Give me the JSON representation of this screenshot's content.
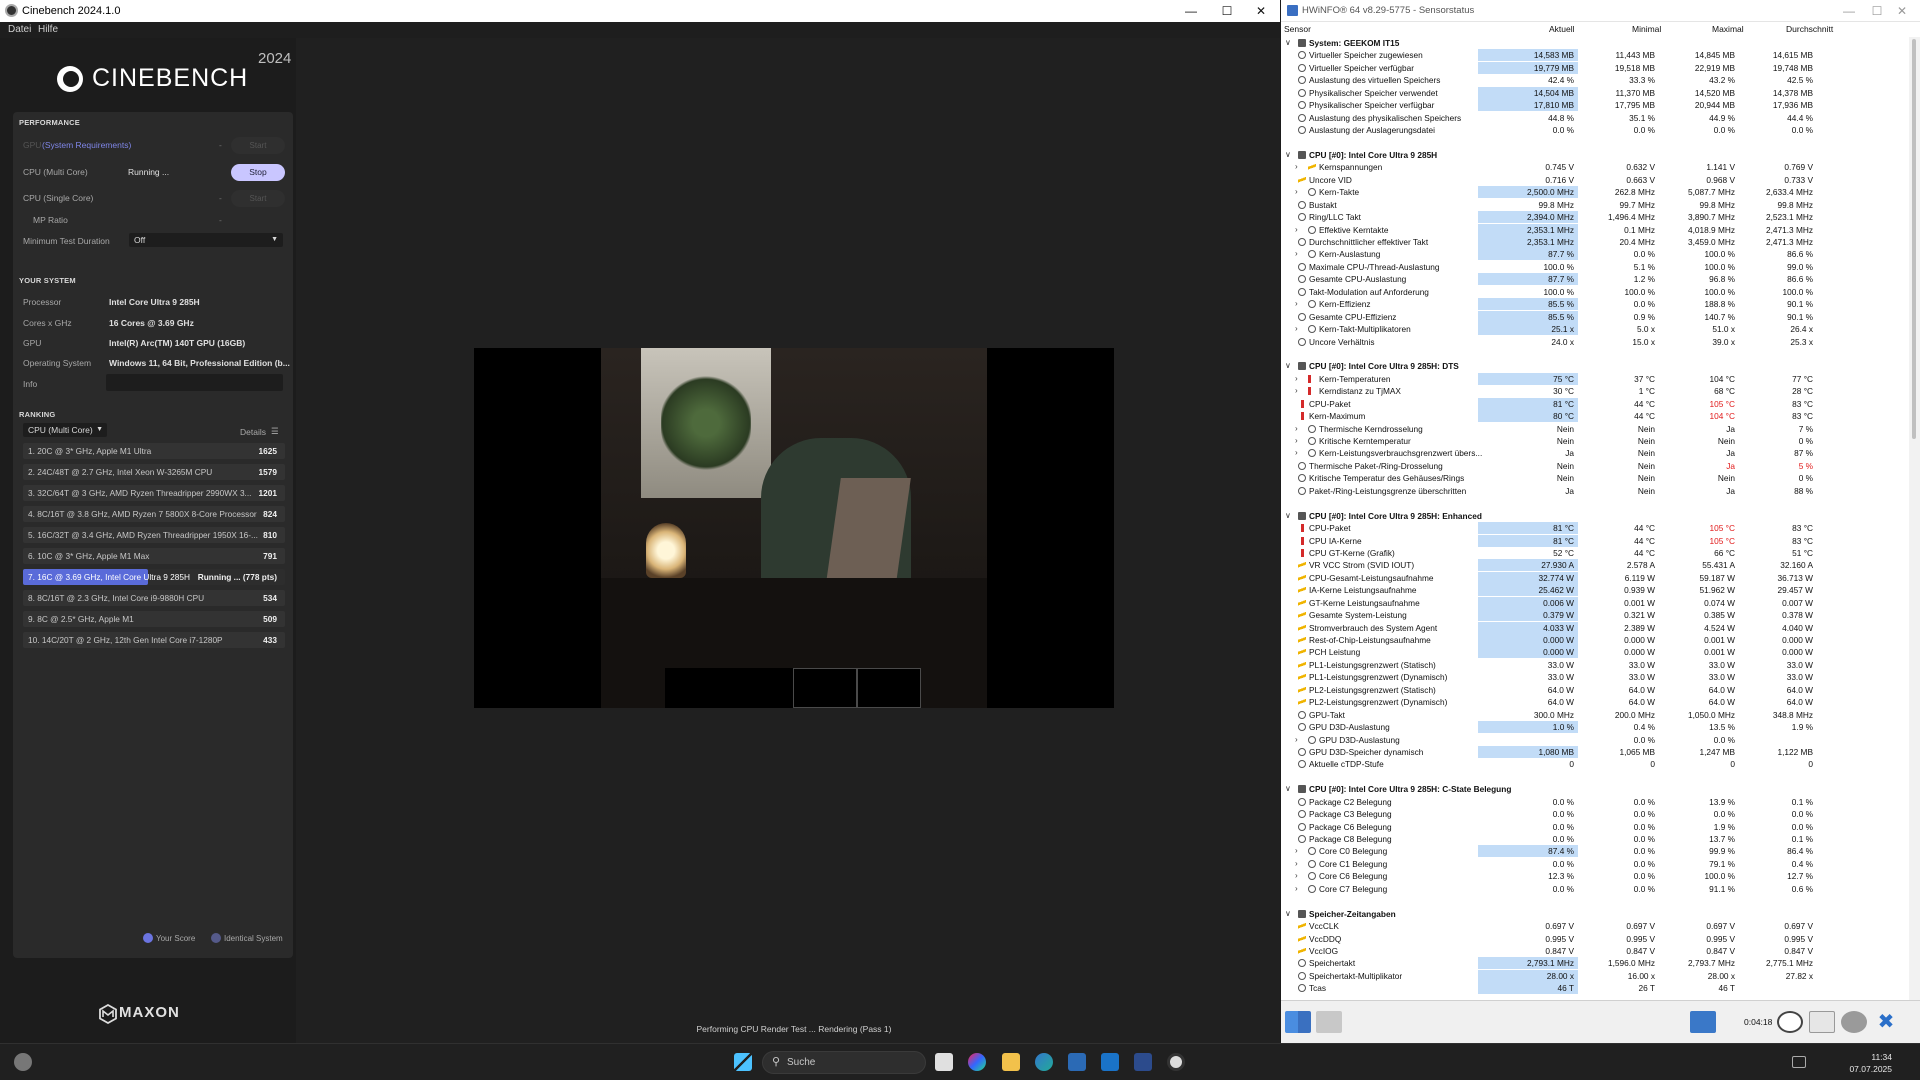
{
  "cinebench": {
    "window_title": "Cinebench 2024.1.0",
    "menu": [
      "Datei",
      "Hilfe"
    ],
    "logo_text": "CINEBENCH",
    "logo_year": "2024",
    "performance": {
      "title": "PERFORMANCE",
      "gpu_label": "GPU",
      "gpu_req_link": "(System Requirements)",
      "gpu_dash": "-",
      "start_label": "Start",
      "multi_label": "CPU (Multi Core)",
      "multi_status": "Running ...",
      "stop_label": "Stop",
      "single_label": "CPU (Single Core)",
      "single_dash": "-",
      "mp_label": "MP Ratio",
      "mp_dash": "-",
      "min_duration_label": "Minimum Test Duration",
      "min_duration_value": "Off"
    },
    "your_system": {
      "title": "YOUR SYSTEM",
      "processor_label": "Processor",
      "processor": "Intel Core Ultra 9 285H",
      "cores_label": "Cores x GHz",
      "cores": "16 Cores @ 3.69 GHz",
      "gpu_label": "GPU",
      "gpu": "Intel(R) Arc(TM) 140T GPU (16GB)",
      "os_label": "Operating System",
      "os": "Windows 11, 64 Bit, Professional Edition (b...",
      "info_label": "Info"
    },
    "ranking": {
      "title": "RANKING",
      "filter": "CPU (Multi Core)",
      "details": "Details",
      "rows": [
        {
          "name": "1. 20C @ 3* GHz, Apple M1 Ultra",
          "score": "1625"
        },
        {
          "name": "2. 24C/48T @ 2.7 GHz, Intel Xeon W-3265M CPU",
          "score": "1579"
        },
        {
          "name": "3. 32C/64T @ 3 GHz, AMD Ryzen Threadripper 2990WX 3...",
          "score": "1201"
        },
        {
          "name": "4. 8C/16T @ 3.8 GHz, AMD Ryzen 7 5800X 8-Core Processor",
          "score": "824"
        },
        {
          "name": "5. 16C/32T @ 3.4 GHz, AMD Ryzen Threadripper 1950X 16-...",
          "score": "810"
        },
        {
          "name": "6. 10C @ 3* GHz, Apple M1 Max",
          "score": "791"
        },
        {
          "name": "7. 16C @ 3.69 GHz, Intel Core Ultra 9 285H",
          "score": "Running ... (778 pts)"
        },
        {
          "name": "8. 8C/16T @ 2.3 GHz, Intel Core i9-9880H CPU",
          "score": "534"
        },
        {
          "name": "9. 8C @ 2.5* GHz, Apple M1",
          "score": "509"
        },
        {
          "name": "10. 14C/20T @ 2 GHz, 12th Gen Intel Core i7-1280P",
          "score": "433"
        }
      ],
      "legend_your": "Your Score",
      "legend_identical": "Identical System"
    },
    "maxon": "MAXON",
    "status": "Performing CPU Render Test ... Rendering (Pass 1)"
  },
  "hwinfo": {
    "window_title": "HWiNFO® 64 v8.29-5775 - Sensorstatus",
    "columns": [
      "Sensor",
      "Aktuell",
      "Minimal",
      "Maximal",
      "Durchschnitt"
    ],
    "groups": [
      {
        "title": "System: GEEKOM IT15",
        "rows": [
          [
            "Virtueller Speicher zugewiesen",
            "14,583 MB",
            "11,443 MB",
            "14,845 MB",
            "14,615 MB",
            "c",
            1,
            0,
            ""
          ],
          [
            "Virtueller Speicher verfügbar",
            "19,779 MB",
            "19,518 MB",
            "22,919 MB",
            "19,748 MB",
            "c",
            1,
            0,
            ""
          ],
          [
            "Auslastung des virtuellen Speichers",
            "42.4 %",
            "33.3 %",
            "43.2 %",
            "42.5 %",
            "c",
            0,
            0,
            ""
          ],
          [
            "Physikalischer Speicher verwendet",
            "14,504 MB",
            "11,370 MB",
            "14,520 MB",
            "14,378 MB",
            "c",
            1,
            0,
            ""
          ],
          [
            "Physikalischer Speicher verfügbar",
            "17,810 MB",
            "17,795 MB",
            "20,944 MB",
            "17,936 MB",
            "c",
            1,
            0,
            ""
          ],
          [
            "Auslastung des physikalischen Speichers",
            "44.8 %",
            "35.1 %",
            "44.9 %",
            "44.4 %",
            "c",
            0,
            0,
            ""
          ],
          [
            "Auslastung der Auslagerungsdatei",
            "0.0 %",
            "0.0 %",
            "0.0 %",
            "0.0 %",
            "c",
            0,
            0,
            ""
          ]
        ]
      },
      {
        "title": "CPU [#0]: Intel Core Ultra 9 285H",
        "rows": [
          [
            "Kernspannungen",
            "0.745 V",
            "0.632 V",
            "1.141 V",
            "0.769 V",
            "b",
            0,
            1,
            ""
          ],
          [
            "Uncore VID",
            "0.716 V",
            "0.663 V",
            "0.968 V",
            "0.733 V",
            "b",
            0,
            0,
            ""
          ],
          [
            "Kern-Takte",
            "2,500.0 MHz",
            "262.8 MHz",
            "5,087.7 MHz",
            "2,633.4 MHz",
            "c",
            1,
            1,
            ""
          ],
          [
            "Bustakt",
            "99.8 MHz",
            "99.7 MHz",
            "99.8 MHz",
            "99.8 MHz",
            "c",
            0,
            0,
            ""
          ],
          [
            "Ring/LLC Takt",
            "2,394.0 MHz",
            "1,496.4 MHz",
            "3,890.7 MHz",
            "2,523.1 MHz",
            "c",
            1,
            0,
            ""
          ],
          [
            "Effektive Kerntakte",
            "2,353.1 MHz",
            "0.1 MHz",
            "4,018.9 MHz",
            "2,471.3 MHz",
            "c",
            1,
            1,
            ""
          ],
          [
            "Durchschnittlicher effektiver Takt",
            "2,353.1 MHz",
            "20.4 MHz",
            "3,459.0 MHz",
            "2,471.3 MHz",
            "c",
            1,
            0,
            ""
          ],
          [
            "Kern-Auslastung",
            "87.7 %",
            "0.0 %",
            "100.0 %",
            "86.6 %",
            "c",
            1,
            1,
            ""
          ],
          [
            "Maximale CPU-/Thread-Auslastung",
            "100.0 %",
            "5.1 %",
            "100.0 %",
            "99.0 %",
            "c",
            0,
            0,
            ""
          ],
          [
            "Gesamte CPU-Auslastung",
            "87.7 %",
            "1.2 %",
            "96.8 %",
            "86.6 %",
            "c",
            1,
            0,
            ""
          ],
          [
            "Takt-Modulation auf Anforderung",
            "100.0 %",
            "100.0 %",
            "100.0 %",
            "100.0 %",
            "c",
            0,
            0,
            ""
          ],
          [
            "Kern-Effizienz",
            "85.5 %",
            "0.0 %",
            "188.8 %",
            "90.1 %",
            "c",
            1,
            1,
            ""
          ],
          [
            "Gesamte CPU-Effizienz",
            "85.5 %",
            "0.9 %",
            "140.7 %",
            "90.1 %",
            "c",
            1,
            0,
            ""
          ],
          [
            "Kern-Takt-Multiplikatoren",
            "25.1 x",
            "5.0 x",
            "51.0 x",
            "26.4 x",
            "c",
            1,
            1,
            ""
          ],
          [
            "Uncore Verhältnis",
            "24.0 x",
            "15.0 x",
            "39.0 x",
            "25.3 x",
            "c",
            0,
            0,
            ""
          ]
        ]
      },
      {
        "title": "CPU [#0]: Intel Core Ultra 9 285H: DTS",
        "rows": [
          [
            "Kern-Temperaturen",
            "75 °C",
            "37 °C",
            "104 °C",
            "77 °C",
            "t",
            1,
            1,
            ""
          ],
          [
            "Kerndistanz zu TjMAX",
            "30 °C",
            "1 °C",
            "68 °C",
            "28 °C",
            "t",
            0,
            1,
            ""
          ],
          [
            "CPU-Paket",
            "81 °C",
            "44 °C",
            "105 °C",
            "83 °C",
            "t",
            1,
            0,
            "m"
          ],
          [
            "Kern-Maximum",
            "80 °C",
            "44 °C",
            "104 °C",
            "83 °C",
            "t",
            1,
            0,
            "m"
          ],
          [
            "Thermische Kerndrosselung",
            "Nein",
            "Nein",
            "Ja",
            "7 %",
            "c",
            0,
            1,
            ""
          ],
          [
            "Kritische Kerntemperatur",
            "Nein",
            "Nein",
            "Nein",
            "0 %",
            "c",
            0,
            1,
            ""
          ],
          [
            "Kern-Leistungsverbrauchsgrenzwert übers...",
            "Ja",
            "Nein",
            "Ja",
            "87 %",
            "c",
            0,
            1,
            ""
          ],
          [
            "Thermische Paket-/Ring-Drosselung",
            "Nein",
            "Nein",
            "Ja",
            "5 %",
            "c",
            0,
            0,
            "ma"
          ],
          [
            "Kritische Temperatur des Gehäuses/Rings",
            "Nein",
            "Nein",
            "Nein",
            "0 %",
            "c",
            0,
            0,
            ""
          ],
          [
            "Paket-/Ring-Leistungsgrenze überschritten",
            "Ja",
            "Nein",
            "Ja",
            "88 %",
            "c",
            0,
            0,
            ""
          ]
        ]
      },
      {
        "title": "CPU [#0]: Intel Core Ultra 9 285H: Enhanced",
        "rows": [
          [
            "CPU-Paket",
            "81 °C",
            "44 °C",
            "105 °C",
            "83 °C",
            "t",
            1,
            0,
            "m"
          ],
          [
            "CPU IA-Kerne",
            "81 °C",
            "44 °C",
            "105 °C",
            "83 °C",
            "t",
            1,
            0,
            "m"
          ],
          [
            "CPU GT-Kerne (Grafik)",
            "52 °C",
            "44 °C",
            "66 °C",
            "51 °C",
            "t",
            0,
            0,
            ""
          ],
          [
            "VR VCC Strom (SVID IOUT)",
            "27.930 A",
            "2.578 A",
            "55.431 A",
            "32.160 A",
            "b",
            1,
            0,
            ""
          ],
          [
            "CPU-Gesamt-Leistungsaufnahme",
            "32.774 W",
            "6.119 W",
            "59.187 W",
            "36.713 W",
            "b",
            1,
            0,
            ""
          ],
          [
            "IA-Kerne Leistungsaufnahme",
            "25.462 W",
            "0.939 W",
            "51.962 W",
            "29.457 W",
            "b",
            1,
            0,
            ""
          ],
          [
            "GT-Kerne Leistungsaufnahme",
            "0.006 W",
            "0.001 W",
            "0.074 W",
            "0.007 W",
            "b",
            1,
            0,
            ""
          ],
          [
            "Gesamte System-Leistung",
            "0.379 W",
            "0.321 W",
            "0.385 W",
            "0.378 W",
            "b",
            1,
            0,
            ""
          ],
          [
            "Stromverbrauch des System Agent",
            "4.033 W",
            "2.389 W",
            "4.524 W",
            "4.040 W",
            "b",
            1,
            0,
            ""
          ],
          [
            "Rest-of-Chip-Leistungsaufnahme",
            "0.000 W",
            "0.000 W",
            "0.001 W",
            "0.000 W",
            "b",
            1,
            0,
            ""
          ],
          [
            "PCH Leistung",
            "0.000 W",
            "0.000 W",
            "0.001 W",
            "0.000 W",
            "b",
            1,
            0,
            ""
          ],
          [
            "PL1-Leistungsgrenzwert (Statisch)",
            "33.0 W",
            "33.0 W",
            "33.0 W",
            "33.0 W",
            "b",
            0,
            0,
            ""
          ],
          [
            "PL1-Leistungsgrenzwert (Dynamisch)",
            "33.0 W",
            "33.0 W",
            "33.0 W",
            "33.0 W",
            "b",
            0,
            0,
            ""
          ],
          [
            "PL2-Leistungsgrenzwert (Statisch)",
            "64.0 W",
            "64.0 W",
            "64.0 W",
            "64.0 W",
            "b",
            0,
            0,
            ""
          ],
          [
            "PL2-Leistungsgrenzwert (Dynamisch)",
            "64.0 W",
            "64.0 W",
            "64.0 W",
            "64.0 W",
            "b",
            0,
            0,
            ""
          ],
          [
            "GPU-Takt",
            "300.0 MHz",
            "200.0 MHz",
            "1,050.0 MHz",
            "348.8 MHz",
            "c",
            0,
            0,
            ""
          ],
          [
            "GPU D3D-Auslastung",
            "1.0 %",
            "0.4 %",
            "13.5 %",
            "1.9 %",
            "c",
            1,
            0,
            ""
          ],
          [
            "GPU D3D-Auslastung",
            "",
            "0.0 %",
            "0.0 %",
            "",
            "c",
            0,
            1,
            ""
          ],
          [
            "GPU D3D-Speicher dynamisch",
            "1,080 MB",
            "1,065 MB",
            "1,247 MB",
            "1,122 MB",
            "c",
            1,
            0,
            ""
          ],
          [
            "Aktuelle cTDP-Stufe",
            "0",
            "0",
            "0",
            "0",
            "c",
            0,
            0,
            ""
          ]
        ]
      },
      {
        "title": "CPU [#0]: Intel Core Ultra 9 285H: C-State Belegung",
        "rows": [
          [
            "Package C2 Belegung",
            "0.0 %",
            "0.0 %",
            "13.9 %",
            "0.1 %",
            "c",
            0,
            0,
            ""
          ],
          [
            "Package C3 Belegung",
            "0.0 %",
            "0.0 %",
            "0.0 %",
            "0.0 %",
            "c",
            0,
            0,
            ""
          ],
          [
            "Package C6 Belegung",
            "0.0 %",
            "0.0 %",
            "1.9 %",
            "0.0 %",
            "c",
            0,
            0,
            ""
          ],
          [
            "Package C8 Belegung",
            "0.0 %",
            "0.0 %",
            "13.7 %",
            "0.1 %",
            "c",
            0,
            0,
            ""
          ],
          [
            "Core C0 Belegung",
            "87.4 %",
            "0.0 %",
            "99.9 %",
            "86.4 %",
            "c",
            1,
            1,
            ""
          ],
          [
            "Core C1 Belegung",
            "0.0 %",
            "0.0 %",
            "79.1 %",
            "0.4 %",
            "c",
            0,
            1,
            ""
          ],
          [
            "Core C6 Belegung",
            "12.3 %",
            "0.0 %",
            "100.0 %",
            "12.7 %",
            "c",
            0,
            1,
            ""
          ],
          [
            "Core C7 Belegung",
            "0.0 %",
            "0.0 %",
            "91.1 %",
            "0.6 %",
            "c",
            0,
            1,
            ""
          ]
        ]
      },
      {
        "title": "Speicher-Zeitangaben",
        "rows": [
          [
            "VccCLK",
            "0.697 V",
            "0.697 V",
            "0.697 V",
            "0.697 V",
            "b",
            0,
            0,
            ""
          ],
          [
            "VccDDQ",
            "0.995 V",
            "0.995 V",
            "0.995 V",
            "0.995 V",
            "b",
            0,
            0,
            ""
          ],
          [
            "VccIOG",
            "0.847 V",
            "0.847 V",
            "0.847 V",
            "0.847 V",
            "b",
            0,
            0,
            ""
          ],
          [
            "Speichertakt",
            "2,793.1 MHz",
            "1,596.0 MHz",
            "2,793.7 MHz",
            "2,775.1 MHz",
            "c",
            1,
            0,
            ""
          ],
          [
            "Speichertakt-Multiplikator",
            "28.00 x",
            "16.00 x",
            "28.00 x",
            "27.82 x",
            "c",
            1,
            0,
            ""
          ],
          [
            "Tcas",
            "46 T",
            "26 T",
            "46 T",
            "",
            "c",
            1,
            0,
            ""
          ]
        ]
      }
    ],
    "timer": "0:04:18"
  },
  "taskbar": {
    "search_placeholder": "Suche",
    "time": "11:34",
    "date": "07.07.2025"
  }
}
